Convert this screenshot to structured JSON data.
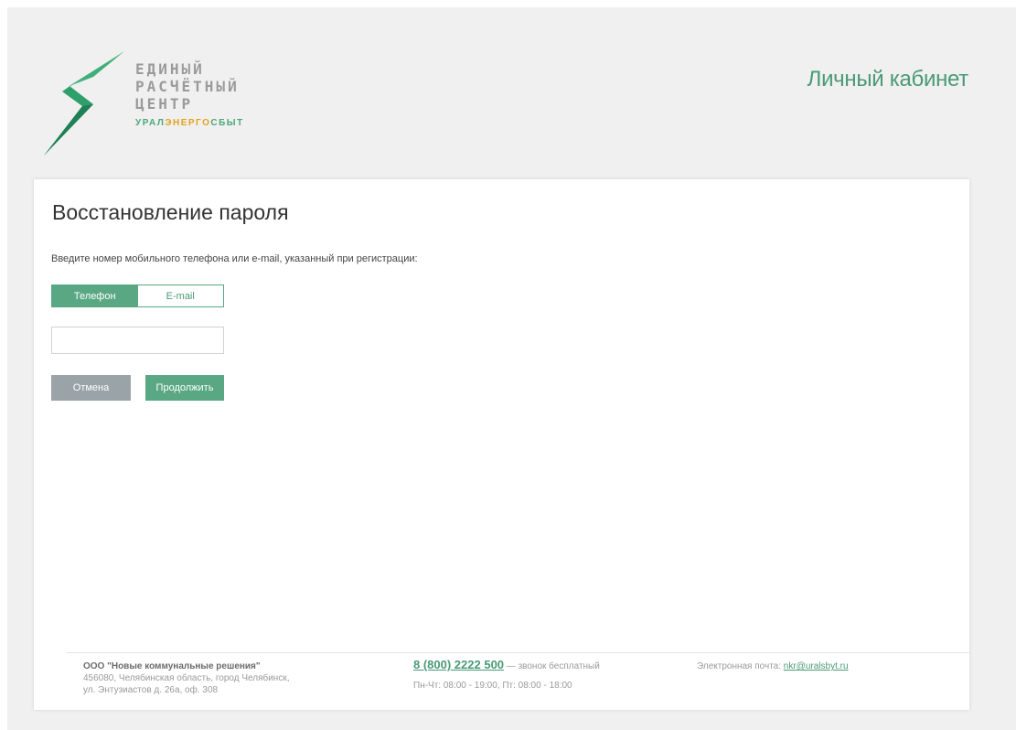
{
  "brand": {
    "logo_lines": [
      "ЕДИНЫЙ",
      "РАСЧЁТНЫЙ",
      "ЦЕНТР"
    ],
    "logo_sub": {
      "a": "УРАЛ",
      "b": "ЭНЕРГО",
      "c": "СБЫТ"
    },
    "cabinet_title": "Личный кабинет",
    "colors": {
      "green": "#4a9a76",
      "green_button": "#5aa883",
      "gray_button": "#9aa3a8",
      "orange": "#e3a21a"
    }
  },
  "form": {
    "title": "Восстановление пароля",
    "instruction": "Введите номер мобильного телефона или e-mail, указанный при регистрации:",
    "tabs": [
      {
        "label": "Телефон",
        "active": true
      },
      {
        "label": "E-mail",
        "active": false
      }
    ],
    "input": {
      "value": "",
      "placeholder": ""
    },
    "cancel_label": "Отмена",
    "continue_label": "Продолжить"
  },
  "footer": {
    "company_name": "ООО \"Новые коммунальные решения\"",
    "address_line1": "456080, Челябинская область, город Челябинск,",
    "address_line2": "ул. Энтузиастов д. 26а, оф. 308",
    "phone": "8 (800) 2222 500",
    "phone_note": " — звонок бесплатный",
    "hours": "Пн-Чт: 08:00 - 19:00, Пт: 08:00 - 18:00",
    "email_label": "Электронная почта: ",
    "email": "nkr@uralsbyt.ru"
  }
}
